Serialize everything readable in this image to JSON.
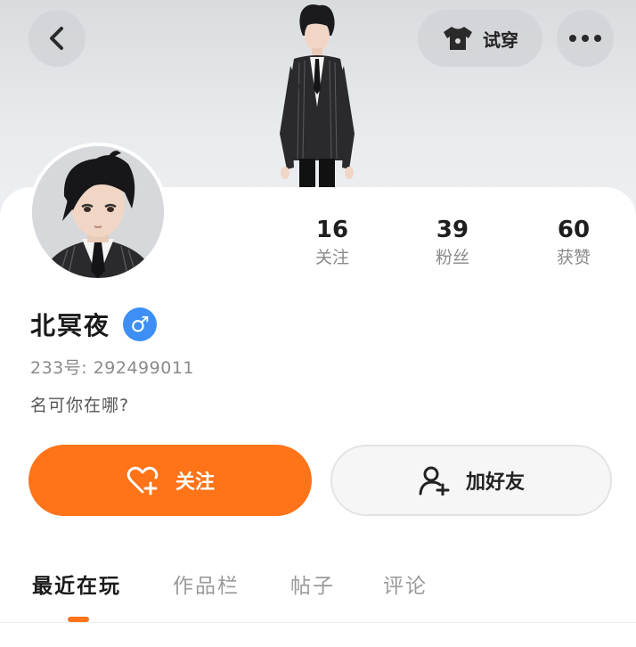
{
  "header": {
    "try_on_label": "试穿"
  },
  "profile": {
    "name": "北冥夜",
    "gender_symbol": "♂",
    "uid": "233号: 292499011",
    "signature": "名可你在哪?"
  },
  "stats": [
    {
      "value": "16",
      "label": "关注"
    },
    {
      "value": "39",
      "label": "粉丝"
    },
    {
      "value": "60",
      "label": "获赞"
    }
  ],
  "actions": {
    "follow_label": "关注",
    "add_friend_label": "加好友"
  },
  "tabs": [
    {
      "label": "最近在玩",
      "active": true
    },
    {
      "label": "作品栏",
      "active": false
    },
    {
      "label": "帖子",
      "active": false
    },
    {
      "label": "评论",
      "active": false
    }
  ],
  "colors": {
    "accent": "#ff7319",
    "gender_badge": "#3d8ff5"
  }
}
